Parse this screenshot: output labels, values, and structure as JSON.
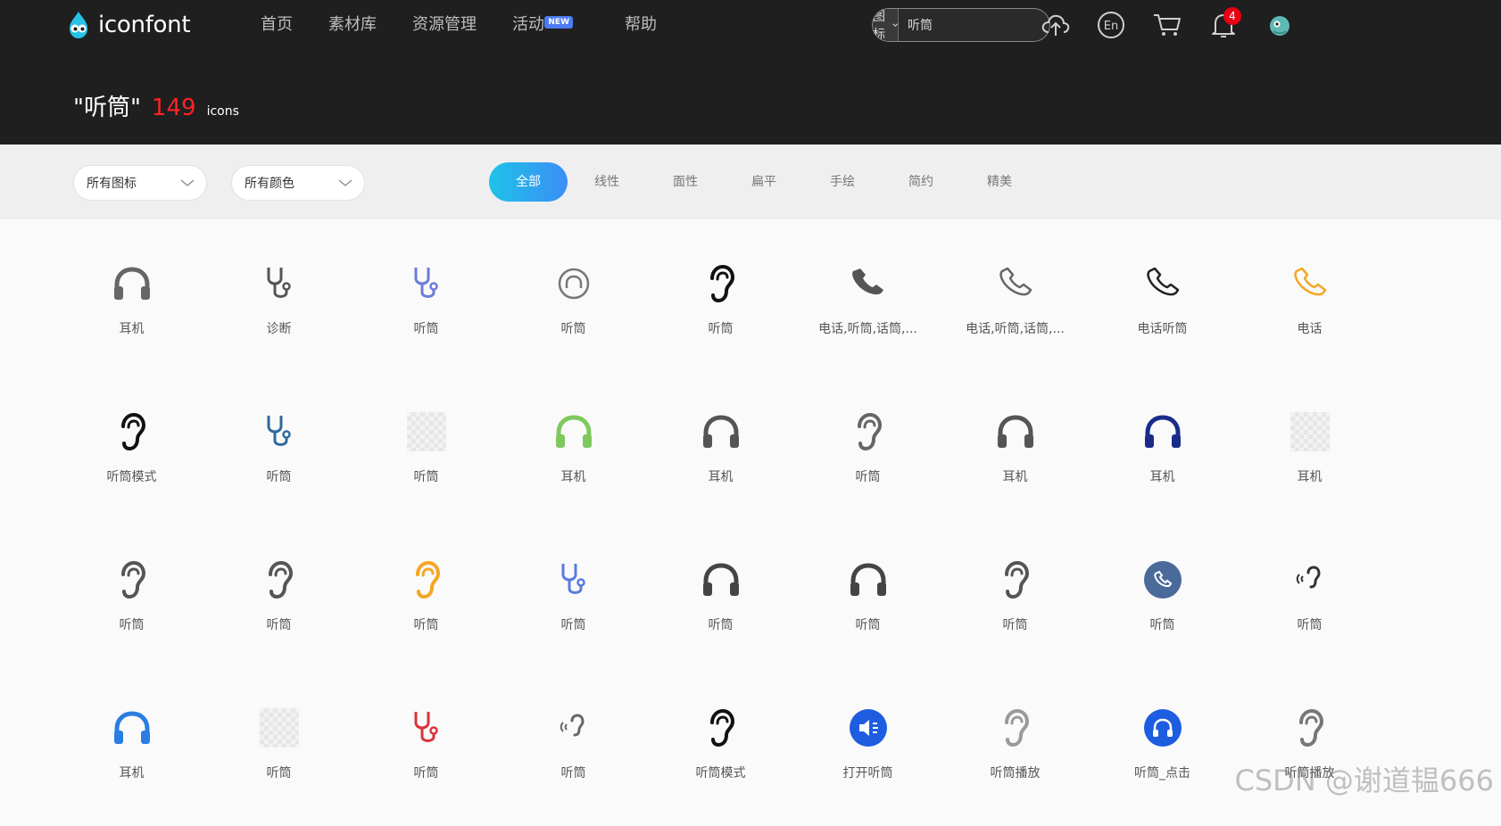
{
  "header": {
    "logo_text": "iconfont",
    "nav": [
      "首页",
      "素材库",
      "资源管理",
      "活动",
      "帮助"
    ],
    "new_badge": "NEW",
    "search": {
      "type_label": "图标",
      "value": "听筒"
    },
    "notification_count": "4",
    "result": {
      "query": "\"听筒\"",
      "count": "149",
      "unit": "icons"
    }
  },
  "filters": {
    "all_icons": "所有图标",
    "all_colors": "所有颜色",
    "tabs": [
      "全部",
      "线性",
      "面性",
      "扁平",
      "手绘",
      "简约",
      "精美"
    ],
    "active_tab": "全部"
  },
  "icons": [
    {
      "label": "耳机",
      "icon": "headphones-icon",
      "color": "#666666"
    },
    {
      "label": "诊断",
      "icon": "stethoscope-icon",
      "color": "#555555"
    },
    {
      "label": "听筒",
      "icon": "stethoscope-icon",
      "color": "#6b7cdb"
    },
    {
      "label": "听筒",
      "icon": "headphones-circle-icon",
      "color": "#777777"
    },
    {
      "label": "听筒",
      "icon": "ear-icon",
      "color": "#111111"
    },
    {
      "label": "电话,听筒,话筒,...",
      "icon": "phone-icon",
      "color": "#555555"
    },
    {
      "label": "电话,听筒,话筒,...",
      "icon": "phone-outline-icon",
      "color": "#666666"
    },
    {
      "label": "电话听筒",
      "icon": "phone-outline-icon",
      "color": "#222222"
    },
    {
      "label": "电话",
      "icon": "phone-outline-icon",
      "color": "#f5a623"
    },
    {
      "label": "听筒模式",
      "icon": "ear-icon",
      "color": "#111111"
    },
    {
      "label": "听筒",
      "icon": "stethoscope-icon",
      "color": "#2e6b9e"
    },
    {
      "label": "听筒",
      "icon": "placeholder-icon",
      "color": "#e6e6e6"
    },
    {
      "label": "耳机",
      "icon": "headphones-icon",
      "color": "#7dc95e"
    },
    {
      "label": "耳机",
      "icon": "headphones-icon",
      "color": "#555555"
    },
    {
      "label": "听筒",
      "icon": "ear-icon",
      "color": "#666666"
    },
    {
      "label": "耳机",
      "icon": "headphones-icon",
      "color": "#555555"
    },
    {
      "label": "耳机",
      "icon": "headphones-icon",
      "color": "#1a2b8a"
    },
    {
      "label": "耳机",
      "icon": "placeholder-icon",
      "color": "#e6e6e6"
    },
    {
      "label": "听筒",
      "icon": "ear-icon",
      "color": "#555555"
    },
    {
      "label": "听筒",
      "icon": "ear-icon",
      "color": "#555555"
    },
    {
      "label": "听筒",
      "icon": "ear-icon",
      "color": "#f5a623"
    },
    {
      "label": "听筒",
      "icon": "stethoscope-icon",
      "color": "#5a7be0"
    },
    {
      "label": "听筒",
      "icon": "headphones-icon",
      "color": "#444444"
    },
    {
      "label": "听筒",
      "icon": "headphones-icon",
      "color": "#444444"
    },
    {
      "label": "听筒",
      "icon": "ear-icon",
      "color": "#555555"
    },
    {
      "label": "听筒",
      "icon": "phone-circle-icon",
      "color": "#4a6a9a"
    },
    {
      "label": "听筒",
      "icon": "ear-sound-icon",
      "color": "#333333"
    },
    {
      "label": "耳机",
      "icon": "headphones-icon",
      "color": "#2a7de1"
    },
    {
      "label": "听筒",
      "icon": "placeholder-icon",
      "color": "#e6e6e6"
    },
    {
      "label": "听筒",
      "icon": "stethoscope-icon",
      "color": "#d9343a"
    },
    {
      "label": "听筒",
      "icon": "ear-sound-icon",
      "color": "#666666"
    },
    {
      "label": "听筒模式",
      "icon": "ear-icon",
      "color": "#111111"
    },
    {
      "label": "打开听筒",
      "icon": "speaker-circle-icon",
      "color": "#1e5de0"
    },
    {
      "label": "听筒播放",
      "icon": "ear-icon",
      "color": "#999999"
    },
    {
      "label": "听筒_点击",
      "icon": "headphones-circle-fill-icon",
      "color": "#1e5de0"
    },
    {
      "label": "听筒播放",
      "icon": "ear-icon",
      "color": "#777777"
    }
  ],
  "watermark": "CSDN @谢道韫666"
}
